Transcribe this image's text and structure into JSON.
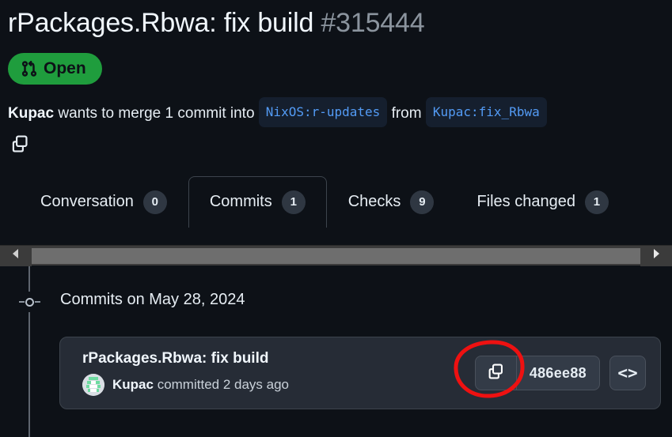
{
  "page": {
    "title": "rPackages.Rbwa: fix build",
    "number": "#315444"
  },
  "state": {
    "label": "Open",
    "icon": "git-pull-request-icon",
    "color": "#1f9d3d"
  },
  "merge_description": {
    "author": "Kupac",
    "text_before": " wants to merge 1 commit into ",
    "base_branch": "NixOS:r-updates",
    "text_between": " from ",
    "head_branch": "Kupac:fix_Rbwa",
    "copy_icon": "copy-icon"
  },
  "tabs": [
    {
      "label": "Conversation",
      "count": "0",
      "active": false
    },
    {
      "label": "Commits",
      "count": "1",
      "active": true
    },
    {
      "label": "Checks",
      "count": "9",
      "active": false
    },
    {
      "label": "Files changed",
      "count": "1",
      "active": false
    }
  ],
  "scrollbar": {
    "left_arrow": "chevron-left-icon",
    "right_arrow": "chevron-right-icon"
  },
  "commits_group": {
    "heading": "Commits on May 28, 2024"
  },
  "commit": {
    "message": "rPackages.Rbwa: fix build",
    "author": "Kupac",
    "meta_suffix": " committed 2 days ago",
    "sha": "486ee88",
    "copy_icon": "copy-icon",
    "code_icon": "code-icon",
    "code_glyph": "<>"
  },
  "annotation": {
    "shape": "red-ellipse-highlight",
    "color": "#ee1111",
    "target": "commit-sha-copy-button"
  }
}
